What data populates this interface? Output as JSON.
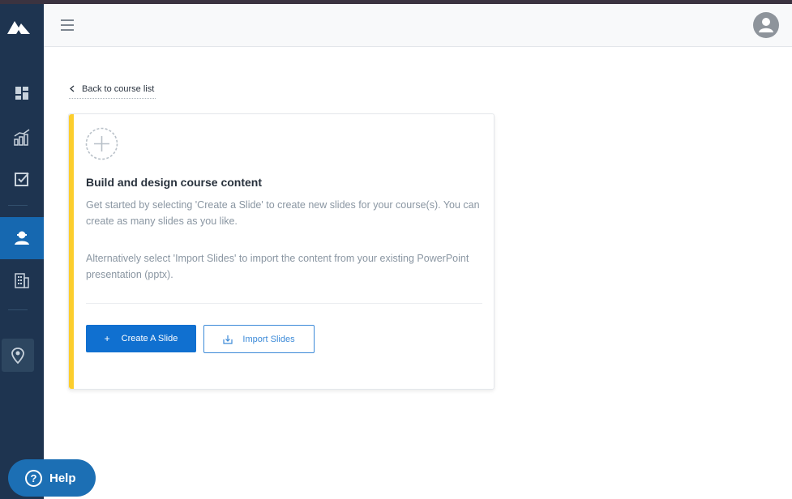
{
  "sidebar": {
    "logo_icon": "mountain-logo",
    "items": [
      {
        "name": "dashboard",
        "icon": "dashboard-icon",
        "active": false
      },
      {
        "name": "reports",
        "icon": "chart-icon",
        "active": false
      },
      {
        "name": "tasks",
        "icon": "checkbox-icon",
        "active": false
      },
      {
        "name": "learner",
        "icon": "user-icon",
        "active": true
      },
      {
        "name": "organization",
        "icon": "building-icon",
        "active": false
      },
      {
        "name": "location",
        "icon": "map-pin-icon",
        "active": false
      }
    ]
  },
  "header": {
    "menu_icon": "hamburger-icon",
    "avatar_icon": "user-avatar-icon"
  },
  "breadcrumb": {
    "back_label": "Back to course list"
  },
  "card": {
    "title": "Build and design course content",
    "text1": "Get started by selecting 'Create a Slide' to create new slides for your course(s). You can create as many slides as you like.",
    "text2": "Alternatively select 'Import Slides' to import the content from your existing PowerPoint presentation (pptx).",
    "create_label": "Create A Slide",
    "import_label": "Import Slides",
    "accent_color": "#fcce2d"
  },
  "help": {
    "label": "Help"
  },
  "colors": {
    "sidebar_bg": "#1e3450",
    "active_nav": "#1668b0",
    "primary": "#1070d0"
  }
}
